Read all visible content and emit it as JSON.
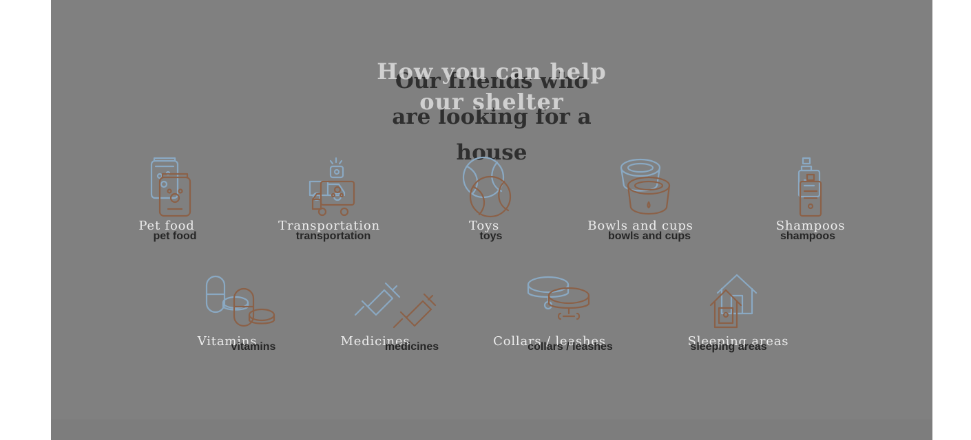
{
  "colors": {
    "page_background": "#ffffff",
    "overlay": "#808080",
    "icon_blue": "#8aa9c3",
    "icon_brown": "#8b6148",
    "dark_text": "#262626",
    "light_text": "#ececec"
  },
  "section": {
    "title_front": "How you can help our shelter",
    "title_back": "Our friends who are looking for a house"
  },
  "help_items": [
    {
      "label": "Pet food",
      "caption": "pet food",
      "icon": "pet-food-icon"
    },
    {
      "label": "Transportation",
      "caption": "transportation",
      "icon": "transport-truck-icon"
    },
    {
      "label": "Toys",
      "caption": "toys",
      "icon": "tennis-ball-icon"
    },
    {
      "label": "Bowls and cups",
      "caption": "bowls and cups",
      "icon": "bowl-icon"
    },
    {
      "label": "Shampoos",
      "caption": "shampoos",
      "icon": "shampoo-bottle-icon"
    },
    {
      "label": "Vitamins",
      "caption": "vitamins",
      "icon": "vitamins-pills-icon"
    },
    {
      "label": "Medicines",
      "caption": "medicines",
      "icon": "syringe-icon"
    },
    {
      "label": "Collars / leashes",
      "caption": "collars / leashes",
      "icon": "collar-icon"
    },
    {
      "label": "Sleeping areas",
      "caption": "sleeping areas",
      "icon": "pet-house-icon"
    }
  ]
}
